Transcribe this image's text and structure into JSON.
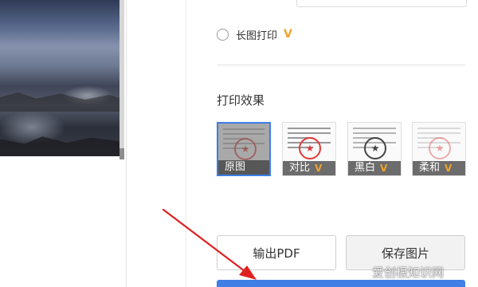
{
  "long_image": {
    "label": "长图打印",
    "vip": "V"
  },
  "effects_section": {
    "title": "打印效果",
    "options": [
      {
        "label": "原图",
        "vip": ""
      },
      {
        "label": "对比",
        "vip": "V"
      },
      {
        "label": "黑白",
        "vip": "V"
      },
      {
        "label": "柔和",
        "vip": "V"
      }
    ],
    "selected": "原图"
  },
  "buttons": {
    "export_pdf": "输出PDF",
    "save_image": "保存图片"
  },
  "watermark": "爱创根知识网",
  "colors": {
    "accent": "#3f7fe6",
    "vip": "#f0a32a",
    "arrow": "#e02020"
  }
}
